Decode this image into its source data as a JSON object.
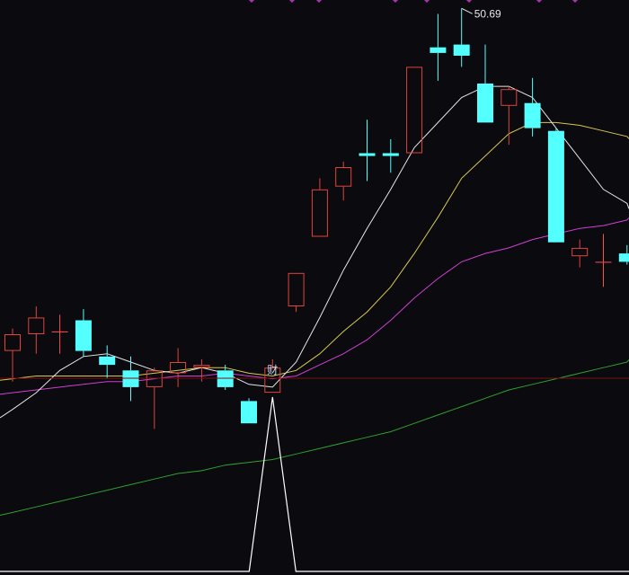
{
  "chart_data": {
    "type": "candlestick",
    "peak_label": "50.69",
    "marker_label": "财",
    "colors": {
      "background": "#0a0a0f",
      "up": "#e0443c",
      "down": "#54ffff",
      "doji_up": "#ff5050",
      "ma_white": "#e6e6e6",
      "ma_yellow": "#d8c850",
      "ma_magenta": "#d040d0",
      "ma_green": "#30a030",
      "separator": "#7a1010",
      "indicator": "#ffffff",
      "top_marks": "#b030b0"
    },
    "candles": [
      {
        "o": 38.4,
        "h": 39.2,
        "l": 37.3,
        "c": 39.0
      },
      {
        "o": 39.0,
        "h": 40.0,
        "l": 38.3,
        "c": 39.6
      },
      {
        "o": 39.1,
        "h": 39.7,
        "l": 38.3,
        "c": 39.1
      },
      {
        "o": 39.5,
        "h": 39.9,
        "l": 38.2,
        "c": 38.4
      },
      {
        "o": 38.2,
        "h": 38.6,
        "l": 37.4,
        "c": 37.9
      },
      {
        "o": 37.7,
        "h": 38.2,
        "l": 36.6,
        "c": 37.1
      },
      {
        "o": 37.1,
        "h": 37.8,
        "l": 35.6,
        "c": 37.7
      },
      {
        "o": 37.6,
        "h": 38.5,
        "l": 37.1,
        "c": 38.0
      },
      {
        "o": 37.8,
        "h": 38.1,
        "l": 37.3,
        "c": 37.9
      },
      {
        "o": 37.7,
        "h": 37.9,
        "l": 37.0,
        "c": 37.1
      },
      {
        "o": 36.6,
        "h": 36.7,
        "l": 35.8,
        "c": 35.8
      },
      {
        "o": 36.9,
        "h": 38.1,
        "l": 36.9,
        "c": 37.8
      },
      {
        "o": 40.0,
        "h": 41.2,
        "l": 39.8,
        "c": 41.2
      },
      {
        "o": 42.5,
        "h": 44.6,
        "l": 42.5,
        "c": 44.2
      },
      {
        "o": 44.3,
        "h": 45.2,
        "l": 43.8,
        "c": 45.0
      },
      {
        "o": 45.5,
        "h": 46.7,
        "l": 44.5,
        "c": 45.4
      },
      {
        "o": 45.5,
        "h": 46.0,
        "l": 44.8,
        "c": 45.4
      },
      {
        "o": 45.5,
        "h": 48.6,
        "l": 45.5,
        "c": 48.6
      },
      {
        "o": 49.3,
        "h": 50.5,
        "l": 48.1,
        "c": 49.1
      },
      {
        "o": 49.4,
        "h": 50.7,
        "l": 48.6,
        "c": 49.0
      },
      {
        "o": 48.0,
        "h": 49.4,
        "l": 46.6,
        "c": 46.6
      },
      {
        "o": 47.2,
        "h": 47.9,
        "l": 45.8,
        "c": 47.8
      },
      {
        "o": 47.3,
        "h": 48.2,
        "l": 46.1,
        "c": 46.4
      },
      {
        "o": 46.3,
        "h": 46.4,
        "l": 42.3,
        "c": 42.3
      },
      {
        "o": 41.8,
        "h": 42.4,
        "l": 41.4,
        "c": 42.1
      },
      {
        "o": 41.6,
        "h": 42.6,
        "l": 40.7,
        "c": 41.6
      },
      {
        "o": 41.9,
        "h": 42.2,
        "l": 41.5,
        "c": 41.6
      }
    ],
    "ma_white": [
      36.3,
      36.9,
      37.7,
      38.2,
      38.3,
      38.0,
      37.7,
      37.6,
      37.8,
      37.6,
      37.2,
      37.1,
      38.0,
      39.6,
      41.3,
      42.8,
      44.2,
      45.7,
      46.6,
      47.5,
      47.9,
      47.9,
      47.5,
      46.4,
      45.3,
      44.2,
      43.7
    ],
    "ma_yellow": [
      37.4,
      37.5,
      37.5,
      37.5,
      37.5,
      37.5,
      37.6,
      37.7,
      37.8,
      37.8,
      37.6,
      37.5,
      37.7,
      38.3,
      39.1,
      39.8,
      40.7,
      41.9,
      43.2,
      44.6,
      45.4,
      46.2,
      46.6,
      46.6,
      46.5,
      46.3,
      46.1
    ],
    "ma_magenta": [
      36.9,
      37.0,
      37.1,
      37.2,
      37.3,
      37.3,
      37.4,
      37.5,
      37.5,
      37.6,
      37.5,
      37.4,
      37.5,
      37.9,
      38.3,
      38.8,
      39.5,
      40.3,
      41.0,
      41.6,
      41.9,
      42.1,
      42.4,
      42.6,
      42.8,
      42.9,
      43.1
    ],
    "ma_green": [
      32.6,
      32.8,
      33.0,
      33.2,
      33.4,
      33.6,
      33.8,
      34.0,
      34.1,
      34.3,
      34.4,
      34.5,
      34.7,
      34.9,
      35.1,
      35.3,
      35.5,
      35.8,
      36.1,
      36.4,
      36.7,
      37.0,
      37.2,
      37.4,
      37.6,
      37.8,
      38.0
    ],
    "indicator_signal": [
      0,
      0,
      0,
      0,
      0,
      0,
      0,
      0,
      0,
      0,
      0,
      1,
      0,
      0,
      0,
      0,
      0,
      0,
      0,
      0,
      0,
      0,
      0,
      0,
      0,
      0,
      0
    ]
  }
}
